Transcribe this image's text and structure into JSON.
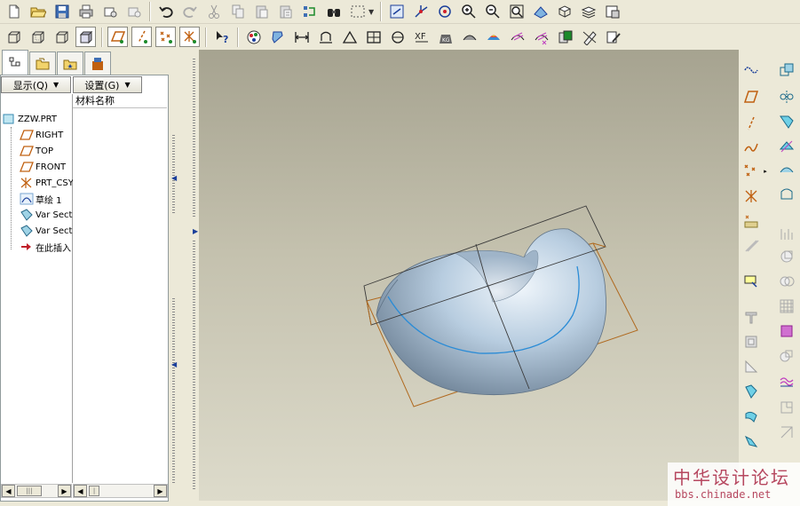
{
  "toolbar_top": [
    "new-icon",
    "open-icon",
    "save-icon",
    "print-icon",
    "email-icon",
    "send-icon",
    "undo-icon",
    "redo-icon",
    "cut-icon",
    "copy-icon",
    "paste-icon",
    "paste-special-icon",
    "regenerate-icon",
    "find-icon",
    "select-box-icon",
    "refit-icon",
    "spin-center-icon",
    "orient-icon",
    "zoom-in-icon",
    "zoom-out-icon",
    "zoom-fit-icon",
    "reorient-icon",
    "saved-views-icon",
    "layers-icon",
    "display-style-icon"
  ],
  "panel": {
    "show_button": "显示(Q)",
    "settings_button": "设置(G)",
    "column_header": "材料名称",
    "tree": [
      {
        "label": "ZZW.PRT",
        "icon": "part-icon"
      },
      {
        "label": "RIGHT",
        "icon": "datum-plane-icon"
      },
      {
        "label": "TOP",
        "icon": "datum-plane-icon"
      },
      {
        "label": "FRONT",
        "icon": "datum-plane-icon"
      },
      {
        "label": "PRT_CSY",
        "icon": "coordinate-system-icon"
      },
      {
        "label": "草绘 1",
        "icon": "sketch-icon"
      },
      {
        "label": "Var Sect",
        "icon": "variable-section-sweep-icon"
      },
      {
        "label": "Var Sect",
        "icon": "variable-section-sweep-icon"
      },
      {
        "label": "在此插入",
        "icon": "insert-here-arrow-icon"
      }
    ]
  },
  "watermark": {
    "title": "中华设计论坛",
    "url": "bbs.chinade.net"
  },
  "colors": {
    "accent_blue": "#1b3f9a",
    "datum_orange": "#c06010",
    "watermark": "#b6475f"
  }
}
